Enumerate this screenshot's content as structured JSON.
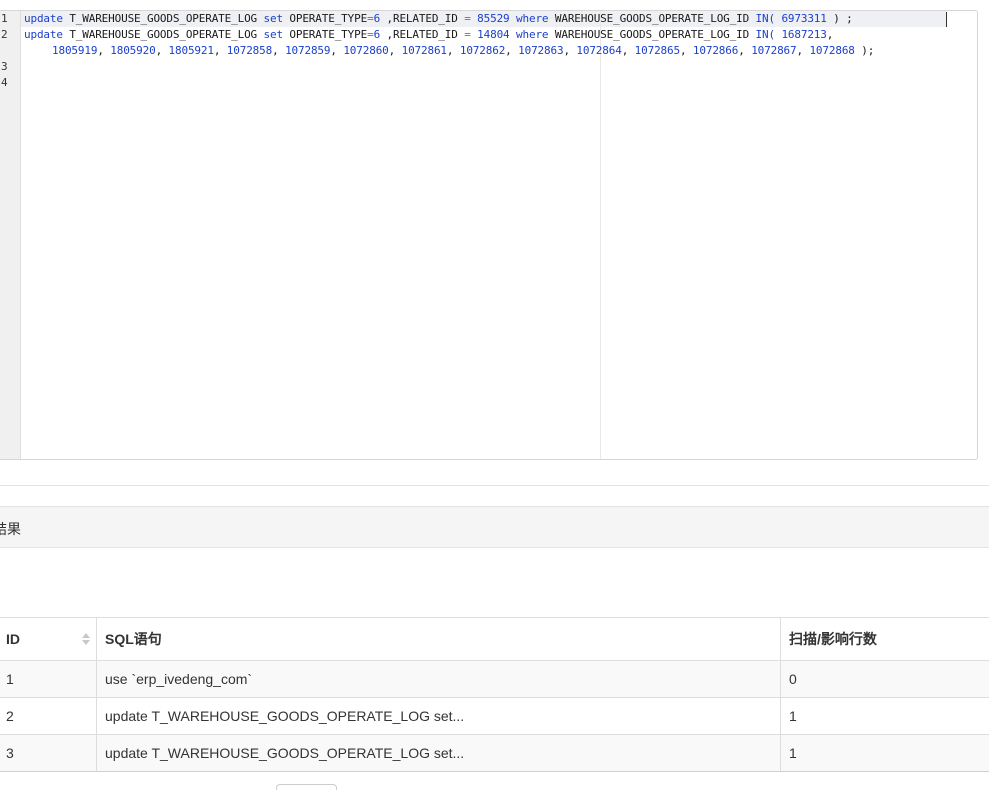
{
  "editor": {
    "line_numbers": [
      "1",
      "2",
      "3",
      "4"
    ],
    "line1": {
      "kw_update": "update",
      "t1": " T_WAREHOUSE_GOODS_OPERATE_LOG ",
      "kw_set": "set",
      "t2": " OPERATE_TYPE",
      "eq1": "=",
      "n1": "6",
      "t3": " ,RELATED_ID ",
      "eq2": "=",
      "t4": " ",
      "n2": "85529",
      "t5": " ",
      "kw_where": "where",
      "t6": " WAREHOUSE_GOODS_OPERATE_LOG_ID ",
      "kw_in": "IN(",
      "t7": " ",
      "n3": "6973311",
      "t8": " ) ;"
    },
    "line2a": {
      "kw_update": "update",
      "t1": " T_WAREHOUSE_GOODS_OPERATE_LOG ",
      "kw_set": "set",
      "t2": " OPERATE_TYPE",
      "eq1": "=",
      "n1": "6",
      "t3": " ,RELATED_ID ",
      "eq2": "=",
      "t4": " ",
      "n2": "14804",
      "t5": " ",
      "kw_where": "where",
      "t6": " WAREHOUSE_GOODS_OPERATE_LOG_ID ",
      "kw_in": "IN(",
      "t7": " ",
      "n3": "1687213",
      "t8": ","
    },
    "line2b_ids": [
      "1805919",
      "1805920",
      "1805921",
      "1072858",
      "1072859",
      "1072860",
      "1072861",
      "1072862",
      "1072863",
      "1072864",
      "1072865",
      "1072866",
      "1072867",
      "1072868"
    ],
    "line2b_end": " );"
  },
  "result": {
    "title": "结果"
  },
  "table": {
    "headers": {
      "id": "ID",
      "sql": "SQL语句",
      "rows": "扫描/影响行数"
    },
    "rows": [
      {
        "id": "1",
        "sql": "use `erp_ivedeng_com`",
        "rows": "0"
      },
      {
        "id": "2",
        "sql": "update T_WAREHOUSE_GOODS_OPERATE_LOG set...",
        "rows": "1"
      },
      {
        "id": "3",
        "sql": "update T_WAREHOUSE_GOODS_OPERATE_LOG set...",
        "rows": "1"
      }
    ]
  },
  "icons": {
    "sort": "sort-icon"
  },
  "colors": {
    "keyword": "#1a3fcc",
    "gutter": "#f0f0f0",
    "header_bg": "#f5f5f5"
  }
}
